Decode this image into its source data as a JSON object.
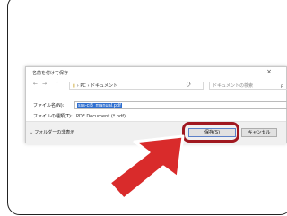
{
  "dialog": {
    "title": "名前を付けて保存",
    "close_icon": "×",
    "nav": {
      "back": "←",
      "forward": "→",
      "up": "↑",
      "path": "› PC › ドキュメント",
      "refresh": "ひ",
      "search_placeholder": "ドキュメントの検索",
      "search_icon": "ρ"
    },
    "filename_label": "ファイル名(N):",
    "filename_value": "sss-ci3_manual.pdf",
    "filetype_label": "ファイルの種類(T):",
    "filetype_value": "PDF Document (*.pdf)",
    "hide_folders_label": "フォルダーの非表示",
    "save_label": "保存(S)",
    "cancel_label": "キャンセル"
  },
  "colors": {
    "highlight": "#a01820",
    "arrow": "#d92b2b",
    "selection": "#2f6fd0"
  }
}
